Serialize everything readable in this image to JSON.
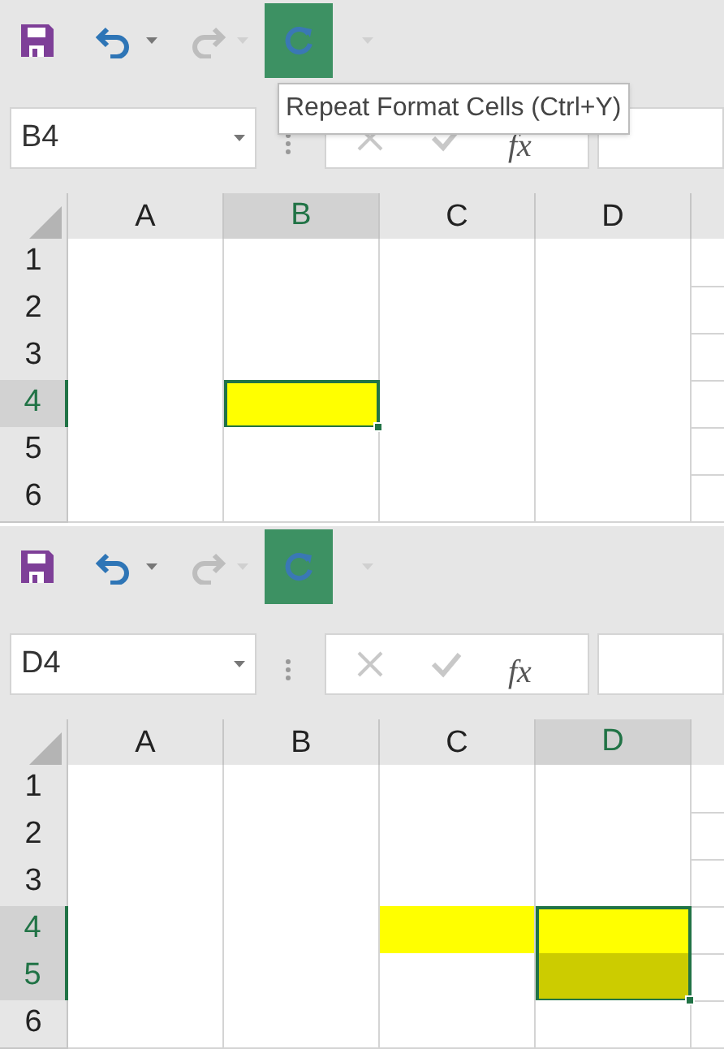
{
  "panels": [
    {
      "toolbar": {
        "undo_enabled": true,
        "redo_enabled": false
      },
      "tooltip": "Repeat Format Cells (Ctrl+Y)",
      "name_box": "B4",
      "function_label": "fx",
      "columns": [
        {
          "label": "A",
          "selected": false
        },
        {
          "label": "B",
          "selected": true
        },
        {
          "label": "C",
          "selected": false
        },
        {
          "label": "D",
          "selected": false
        }
      ],
      "rows": [
        {
          "label": "1",
          "selected": false,
          "cells": [
            {
              "selected": false
            },
            {
              "selected": false
            },
            {
              "selected": false
            },
            {
              "selected": false
            }
          ]
        },
        {
          "label": "2",
          "selected": false,
          "cells": [
            {
              "selected": false
            },
            {
              "selected": false
            },
            {
              "selected": false
            },
            {
              "selected": false
            }
          ]
        },
        {
          "label": "3",
          "selected": false,
          "cells": [
            {
              "selected": false
            },
            {
              "selected": false
            },
            {
              "selected": false
            },
            {
              "selected": false
            }
          ]
        },
        {
          "label": "4",
          "selected": true,
          "cells": [
            {
              "selected": false
            },
            {
              "selected": true,
              "color": "#ffff00"
            },
            {
              "selected": false
            },
            {
              "selected": false
            }
          ]
        },
        {
          "label": "5",
          "selected": false,
          "cells": [
            {
              "selected": false
            },
            {
              "selected": false
            },
            {
              "selected": false
            },
            {
              "selected": false
            }
          ]
        },
        {
          "label": "6",
          "selected": false,
          "cells": [
            {
              "selected": false
            },
            {
              "selected": false
            },
            {
              "selected": false
            },
            {
              "selected": false
            }
          ]
        }
      ]
    },
    {
      "toolbar": {
        "undo_enabled": true,
        "redo_enabled": false
      },
      "name_box": "D4",
      "function_label": "fx",
      "columns": [
        {
          "label": "A",
          "selected": false
        },
        {
          "label": "B",
          "selected": false
        },
        {
          "label": "C",
          "selected": false
        },
        {
          "label": "D",
          "selected": true
        }
      ],
      "rows": [
        {
          "label": "1",
          "selected": false,
          "cells": [
            {
              "selected": false
            },
            {
              "selected": false
            },
            {
              "selected": false
            },
            {
              "selected": false
            }
          ]
        },
        {
          "label": "2",
          "selected": false,
          "cells": [
            {
              "selected": false
            },
            {
              "selected": false
            },
            {
              "selected": false
            },
            {
              "selected": false
            }
          ]
        },
        {
          "label": "3",
          "selected": false,
          "cells": [
            {
              "selected": false
            },
            {
              "selected": false
            },
            {
              "selected": false
            },
            {
              "selected": false
            }
          ]
        },
        {
          "label": "4",
          "selected": true,
          "cells": [
            {
              "selected": false
            },
            {
              "selected": false
            },
            {
              "selected": false,
              "color": "#ffff00"
            },
            {
              "selected": true,
              "color": "#ffff00"
            }
          ]
        },
        {
          "label": "5",
          "selected": true,
          "cells": [
            {
              "selected": false
            },
            {
              "selected": false
            },
            {
              "selected": false
            },
            {
              "selected": true,
              "color": "#cccc00"
            }
          ]
        },
        {
          "label": "6",
          "selected": false,
          "cells": [
            {
              "selected": false
            },
            {
              "selected": false
            },
            {
              "selected": false
            },
            {
              "selected": false
            }
          ]
        }
      ]
    }
  ]
}
